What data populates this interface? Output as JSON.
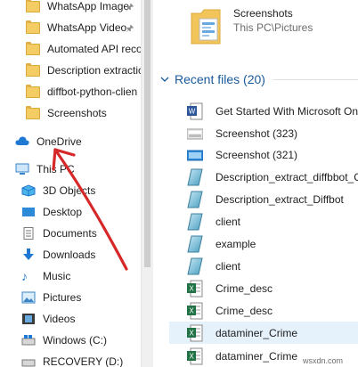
{
  "nav": {
    "quick_access": [
      {
        "label": "WhatsApp Image",
        "pinned": true
      },
      {
        "label": "WhatsApp Video",
        "pinned": true
      },
      {
        "label": "Automated API reco",
        "pinned": false
      },
      {
        "label": "Description extractic",
        "pinned": false
      },
      {
        "label": "diffbot-python-clien",
        "pinned": false
      },
      {
        "label": "Screenshots",
        "pinned": false
      }
    ],
    "onedrive": "OneDrive",
    "this_pc": "This PC",
    "pc_items": [
      "3D Objects",
      "Desktop",
      "Documents",
      "Downloads",
      "Music",
      "Pictures",
      "Videos",
      "Windows (C:)",
      "RECOVERY (D:)"
    ]
  },
  "folder": {
    "name": "Screenshots",
    "path": "This PC\\Pictures"
  },
  "recent": {
    "header": "Recent files (20)",
    "files": [
      {
        "name": "Get Started With Microsoft On",
        "icon": "word-doc-icon"
      },
      {
        "name": "Screenshot (323)",
        "icon": "image-file-icon"
      },
      {
        "name": "Screenshot (321)",
        "icon": "image-file-icon"
      },
      {
        "name": "Description_extract_diffbbot_C",
        "icon": "python-file-icon"
      },
      {
        "name": "Description_extract_Diffbot",
        "icon": "python-file-icon"
      },
      {
        "name": "client",
        "icon": "python-file-icon"
      },
      {
        "name": "example",
        "icon": "python-file-icon"
      },
      {
        "name": "client",
        "icon": "python-file-icon"
      },
      {
        "name": "Crime_desc",
        "icon": "excel-file-icon"
      },
      {
        "name": "Crime_desc",
        "icon": "excel-file-icon"
      },
      {
        "name": "dataminer_Crime",
        "icon": "excel-file-icon"
      },
      {
        "name": "dataminer_Crime",
        "icon": "excel-file-icon"
      }
    ]
  },
  "watermark": "wsxdn.com",
  "colors": {
    "accent": "#1a5a9a",
    "arrow": "#d62828",
    "selected": "#e5f1fb",
    "folder": "#f4cc64"
  }
}
